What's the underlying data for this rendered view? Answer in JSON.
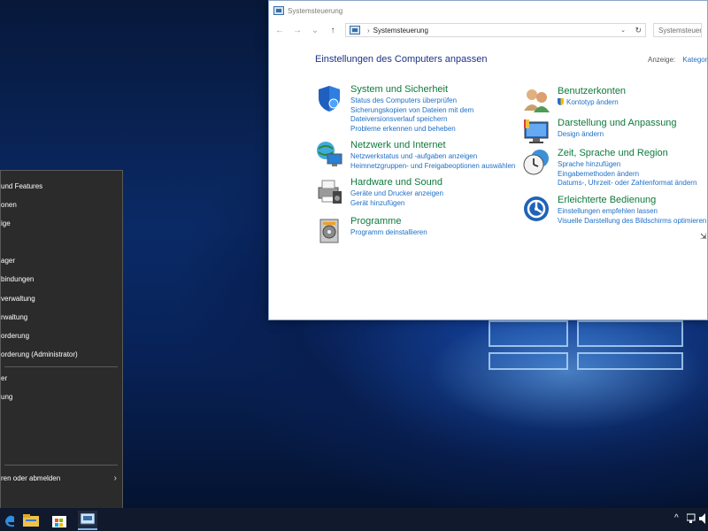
{
  "window": {
    "title": "Systemsteuerung",
    "nav": {
      "back": "←",
      "forward": "→",
      "recent": "⌄",
      "up": "↑"
    },
    "address": {
      "separator": "›",
      "location": "Systemsteuerung",
      "dropdown": "⌄",
      "refresh": "↻"
    },
    "search_placeholder": "Systemsteuerung d",
    "heading": "Einstellungen des Computers anpassen",
    "view_label": "Anzeige:",
    "view_value": "Kategorie"
  },
  "categories": [
    {
      "title": "System und Sicherheit",
      "icon": "shield-icon",
      "links": [
        "Status des Computers überprüfen",
        "Sicherungskopien von Dateien mit dem",
        "Dateiversionsverlauf speichern",
        "Probleme erkennen und beheben"
      ]
    },
    {
      "title": "Netzwerk und Internet",
      "icon": "network-globe-icon",
      "links": [
        "Netzwerkstatus und -aufgaben anzeigen",
        "Heimnetzgruppen- und Freigabeoptionen auswählen"
      ]
    },
    {
      "title": "Hardware und Sound",
      "icon": "printer-speaker-icon",
      "links": [
        "Geräte und Drucker anzeigen",
        "Gerät hinzufügen"
      ]
    },
    {
      "title": "Programme",
      "icon": "programs-disc-icon",
      "links": [
        "Programm deinstallieren"
      ]
    },
    {
      "title": "Benutzerkonten",
      "icon": "users-icon",
      "links": [
        "Kontotyp ändern"
      ]
    },
    {
      "title": "Darstellung und Anpassung",
      "icon": "display-icon",
      "links": [
        "Design ändern"
      ]
    },
    {
      "title": "Zeit, Sprache und Region",
      "icon": "clock-globe-icon",
      "links": [
        "Sprache hinzufügen",
        "Eingabemethoden ändern",
        "Datums-, Uhrzeit- oder Zahlenformat ändern"
      ]
    },
    {
      "title": "Erleichterte Bedienung",
      "icon": "accessibility-icon",
      "links": [
        "Einstellungen empfehlen lassen",
        "Visuelle Darstellung des Bildschirms optimieren"
      ]
    }
  ],
  "menu": {
    "items": [
      "und Features",
      "onen",
      "ige",
      "ager",
      "bindungen",
      "verwaltung",
      "rwaltung",
      "orderung",
      "orderung (Administrator)",
      "er",
      "ung",
      "ren oder abmelden"
    ],
    "arrow": "›"
  },
  "taskbar": {
    "tray_chevron": "^",
    "colors": {
      "bar": "#101a2c",
      "accent": "#7db6f0"
    }
  },
  "colors": {
    "category_title": "#0e7a3c",
    "link": "#1e6fc8",
    "heading": "#1e3287",
    "menu_bg": "#2b2b2b"
  }
}
